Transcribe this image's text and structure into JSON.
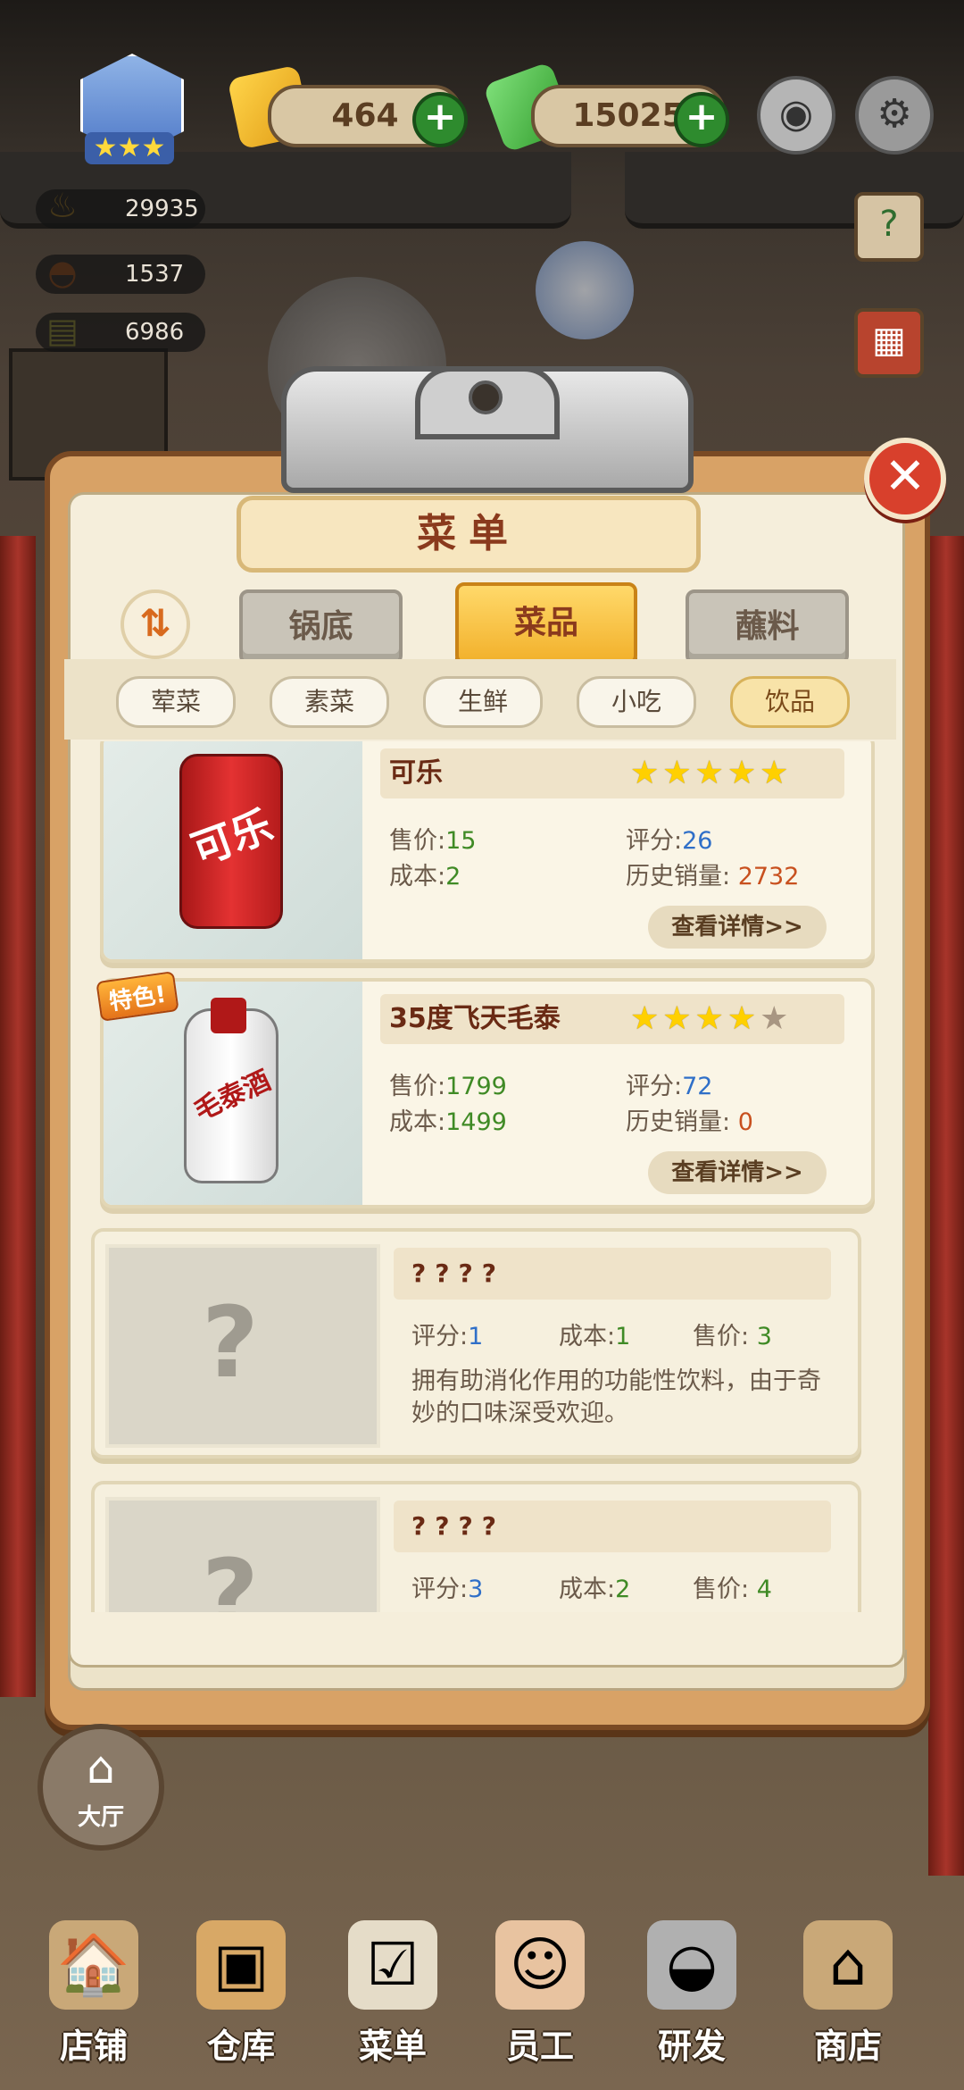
{
  "hud": {
    "gem_count": "464",
    "cash_count": "15025",
    "plus_symbol": "+",
    "stats": [
      "29935",
      "1537",
      "6986"
    ]
  },
  "panel": {
    "title": "菜单",
    "close_symbol": "✕",
    "sort_symbol": "⇅",
    "tabs": [
      "锅底",
      "菜品",
      "蘸料"
    ],
    "chips": [
      "荤菜",
      "素菜",
      "生鲜",
      "小吃",
      "饮品"
    ]
  },
  "items": [
    {
      "name": "可乐",
      "price_label": "售价:",
      "price": "15",
      "cost_label": "成本:",
      "cost": "2",
      "score_label": "评分:",
      "score": "26",
      "sales_label": "历史销量:",
      "sales": "2732",
      "stars": 5,
      "detail": "查看详情>>",
      "can_text": "可乐"
    },
    {
      "name": "35度飞天毛泰",
      "badge": "特色!",
      "price_label": "售价:",
      "price": "1799",
      "cost_label": "成本:",
      "cost": "1499",
      "score_label": "评分:",
      "score": "72",
      "sales_label": "历史销量:",
      "sales": "0",
      "stars": 4,
      "detail": "查看详情>>",
      "bottle_text": "毛泰酒"
    }
  ],
  "locked": [
    {
      "name": "????",
      "score_label": "评分:",
      "score": "1",
      "cost_label": "成本:",
      "cost": "1",
      "price_label": "售价:",
      "price": "3",
      "desc": "拥有助消化作用的功能性饮料，由于奇妙的口味深受欢迎。",
      "qmark": "?"
    },
    {
      "name": "????",
      "score_label": "评分:",
      "score": "3",
      "cost_label": "成本:",
      "cost": "2",
      "price_label": "售价:",
      "price": "4",
      "qmark": "?"
    }
  ],
  "hall_label": "大厅",
  "nav": [
    "店铺",
    "仓库",
    "菜单",
    "员工",
    "研发",
    "商店"
  ],
  "colors": {
    "accent": "#f2b12c",
    "brand_red": "#d8402c",
    "plus_green": "#2e8b2e"
  }
}
